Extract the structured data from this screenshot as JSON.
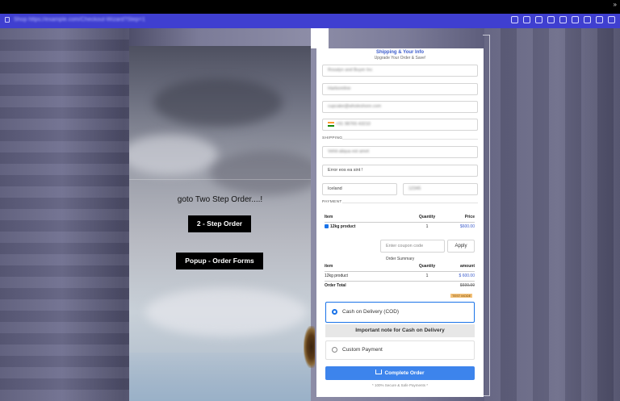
{
  "browser": {
    "url": "Shop https://example.com/Checkout-Wizard?Step=1"
  },
  "left": {
    "heading": "goto Two Step Order....!",
    "step_button": "2 - Step Order",
    "popup_button": "Popup - Order Forms"
  },
  "form": {
    "title": "Shipping & Your Info",
    "subtitle": "Upgrade Your Order & Save!",
    "name": "Rosalyn and Buyer Inc",
    "last_name": "Harboreline",
    "email": "cupcake@wholeshore.com",
    "phone": "+91 98765 43210",
    "shipping_label": "SHIPPING",
    "address1": "Vehit aliqua est amet",
    "address2": "Error eos ea sint !",
    "country": "Iceland",
    "zip": "12345",
    "payment_label": "PAYMENT",
    "items_table": {
      "headers": [
        "Item",
        "Quantity",
        "Price"
      ],
      "rows": [
        [
          "12kg product",
          "1",
          "$600.00"
        ]
      ]
    },
    "coupon_placeholder": "Enter coupon code",
    "apply_label": "Apply",
    "summary_label": "Order Summary",
    "summary_table": {
      "headers": [
        "item",
        "Quantity",
        "amount"
      ],
      "rows": [
        [
          "12kg product",
          "1",
          "$ 600.00"
        ]
      ],
      "total_label": "Order Total",
      "total_value": "$600.00"
    },
    "test_badge": "TEST MODE",
    "payment_options": {
      "cod": "Cash on Delivery (COD)",
      "cod_note": "Important note for Cash on Delivery",
      "custom": "Custom Payment"
    },
    "complete_label": "Complete Order",
    "secure_text": "* 100% Secure & Safe Payments *"
  },
  "colors": {
    "accent": "#3d84ec",
    "browser_bar": "#3f3fd0",
    "title": "#3a5bcc"
  },
  "icons": [
    "lock-icon",
    "menu-icon",
    "cart-icon",
    "india-flag-icon"
  ]
}
